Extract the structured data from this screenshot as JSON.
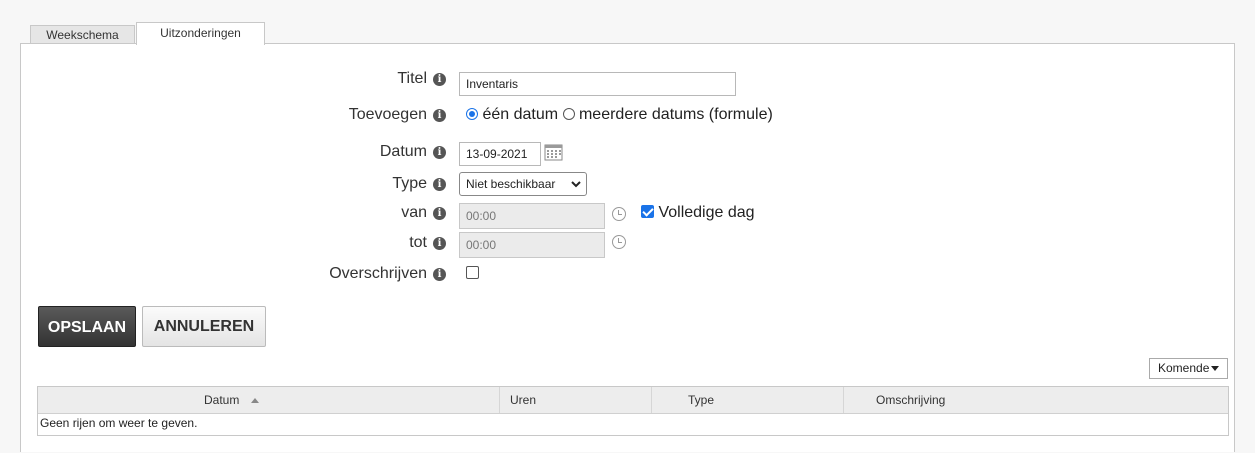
{
  "tabs": [
    {
      "label": "Weekschema"
    },
    {
      "label": "Uitzonderingen",
      "active": true
    }
  ],
  "form": {
    "titel": {
      "label": "Titel",
      "value": "Inventaris"
    },
    "toevoegen": {
      "label": "Toevoegen",
      "options": [
        {
          "label": "één datum",
          "selected": true
        },
        {
          "label": "meerdere datums (formule)",
          "selected": false
        }
      ]
    },
    "datum": {
      "label": "Datum",
      "value": "13-09-2021"
    },
    "type": {
      "label": "Type",
      "value": "Niet beschikbaar"
    },
    "van": {
      "label": "van",
      "value": "00:00"
    },
    "volledige_dag": {
      "label": "Volledige dag",
      "checked": true
    },
    "tot": {
      "label": "tot",
      "value": "00:00"
    },
    "overschrijven": {
      "label": "Overschrijven",
      "checked": false
    },
    "info_glyph": "i"
  },
  "buttons": {
    "save": "OPSLAAN",
    "cancel": "ANNULEREN"
  },
  "filter": {
    "value": "Komende"
  },
  "grid": {
    "columns": [
      "Datum",
      "Uren",
      "Type",
      "Omschrijving"
    ],
    "sort_column": "Datum",
    "sort_direction": "ascending",
    "empty_text": "Geen rijen om weer te geven."
  },
  "colors": {
    "accent": "#1a73e8",
    "save_button": "#3f3f3f"
  }
}
